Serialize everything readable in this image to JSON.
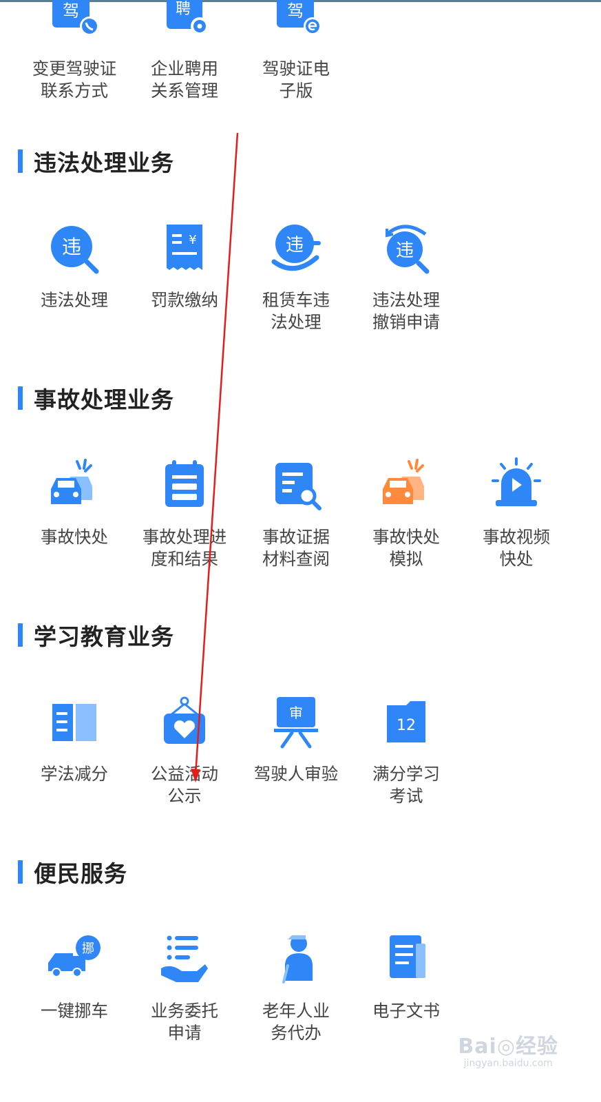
{
  "colors": {
    "accent": "#2f86f6",
    "accent_light": "#8bc0ff",
    "orange": "#ff8a3d",
    "annotation_red": "#e51c1c"
  },
  "top_row": [
    {
      "label": "变更驾驶证\n联系方式",
      "icon": "license-phone-icon",
      "glyph": "驾"
    },
    {
      "label": "企业聘用\n关系管理",
      "icon": "employment-gear-icon",
      "glyph": "聘"
    },
    {
      "label": "驾驶证电\n子版",
      "icon": "license-electronic-icon",
      "glyph": "驾"
    }
  ],
  "sections": [
    {
      "title": "违法处理业务",
      "items": [
        {
          "label": "违法处理",
          "icon": "violation-search-icon",
          "glyph": "违"
        },
        {
          "label": "罚款缴纳",
          "icon": "fine-receipt-icon",
          "glyph": "¥"
        },
        {
          "label": "租赁车违\n法处理",
          "icon": "rental-violation-icon",
          "glyph": "违"
        },
        {
          "label": "违法处理\n撤销申请",
          "icon": "violation-revoke-icon",
          "glyph": "违"
        }
      ]
    },
    {
      "title": "事故处理业务",
      "items": [
        {
          "label": "事故快处",
          "icon": "accident-cars-icon"
        },
        {
          "label": "事故处理进\n度和结果",
          "icon": "accident-progress-icon"
        },
        {
          "label": "事故证据\n材料查阅",
          "icon": "evidence-search-icon"
        },
        {
          "label": "事故快处\n模拟",
          "icon": "accident-simulation-icon"
        },
        {
          "label": "事故视频\n快处",
          "icon": "video-alarm-icon"
        }
      ]
    },
    {
      "title": "学习教育业务",
      "items": [
        {
          "label": "学法减分",
          "icon": "study-book-icon"
        },
        {
          "label": "公益活动\n公示",
          "icon": "charity-heart-icon"
        },
        {
          "label": "驾驶人审验",
          "icon": "driver-review-icon",
          "glyph": "审"
        },
        {
          "label": "满分学习\n考试",
          "icon": "full-score-calendar-icon",
          "glyph": "12"
        }
      ]
    },
    {
      "title": "便民服务",
      "items": [
        {
          "label": "一键挪车",
          "icon": "move-car-icon",
          "glyph": "挪"
        },
        {
          "label": "业务委托\n申请",
          "icon": "entrust-hand-icon"
        },
        {
          "label": "老年人业\n务代办",
          "icon": "elderly-icon"
        },
        {
          "label": "电子文书",
          "icon": "e-document-icon"
        }
      ]
    }
  ],
  "watermark": {
    "main": "Bai◎经验",
    "sub": "jingyan.baidu.com"
  }
}
